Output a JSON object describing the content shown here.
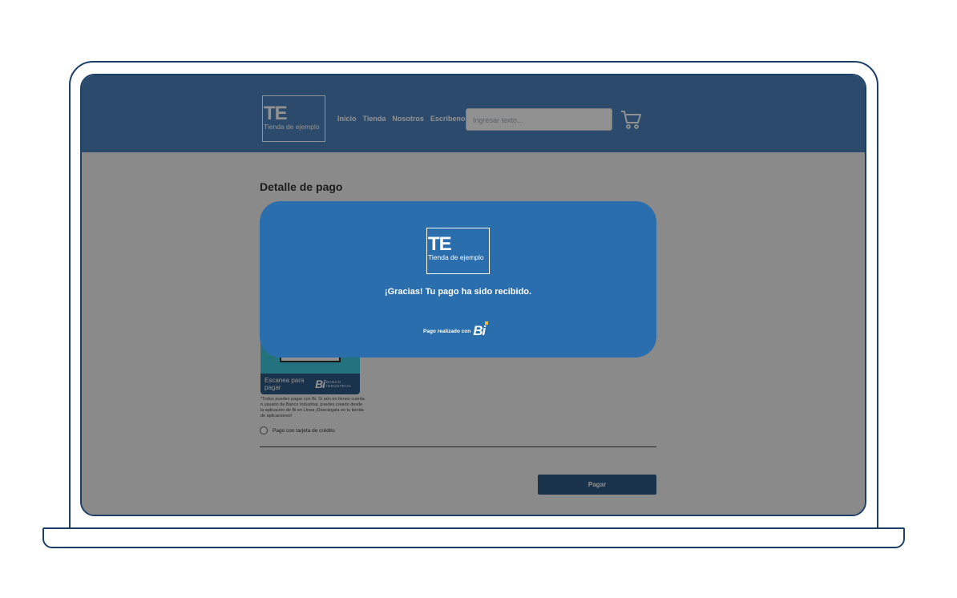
{
  "header": {
    "logo_big": "TE",
    "logo_small": "Tienda de ejemplo",
    "nav": [
      "Inicio",
      "Tienda",
      "Nosotros",
      "Escríbenos"
    ],
    "search_placeholder": "Ingresar texto...",
    "cart_icon": "cart-icon"
  },
  "page": {
    "title": "Detalle de pago",
    "qr_scan_label": "Escanea para pagar",
    "qr_brand_mark": "Bi",
    "qr_brand_text": "BANCO INDUSTRIAL",
    "note": "*Todos pueden pagar con Bi. Si aún no tienes cuenta o usuario de Banco Industrial, puedes crearlo desde la aplicación de Bi en Línea ¡Descárgala en tu tienda de aplicaciones!",
    "radio_label": "Pago con tarjeta de crédito",
    "pay_button": "Pagar"
  },
  "modal": {
    "logo_big": "TE",
    "logo_small": "Tienda de ejemplo",
    "message": "¡Gracias! Tu pago ha sido recibido.",
    "footer_label": "Pago realizado con",
    "footer_brand": "Bi"
  },
  "colors": {
    "header_bg": "#3f79b8",
    "modal_bg": "#2a6ead",
    "button_bg": "#1c4c7e",
    "frame": "#1d3f66",
    "brand_accent": "#f2c230"
  }
}
